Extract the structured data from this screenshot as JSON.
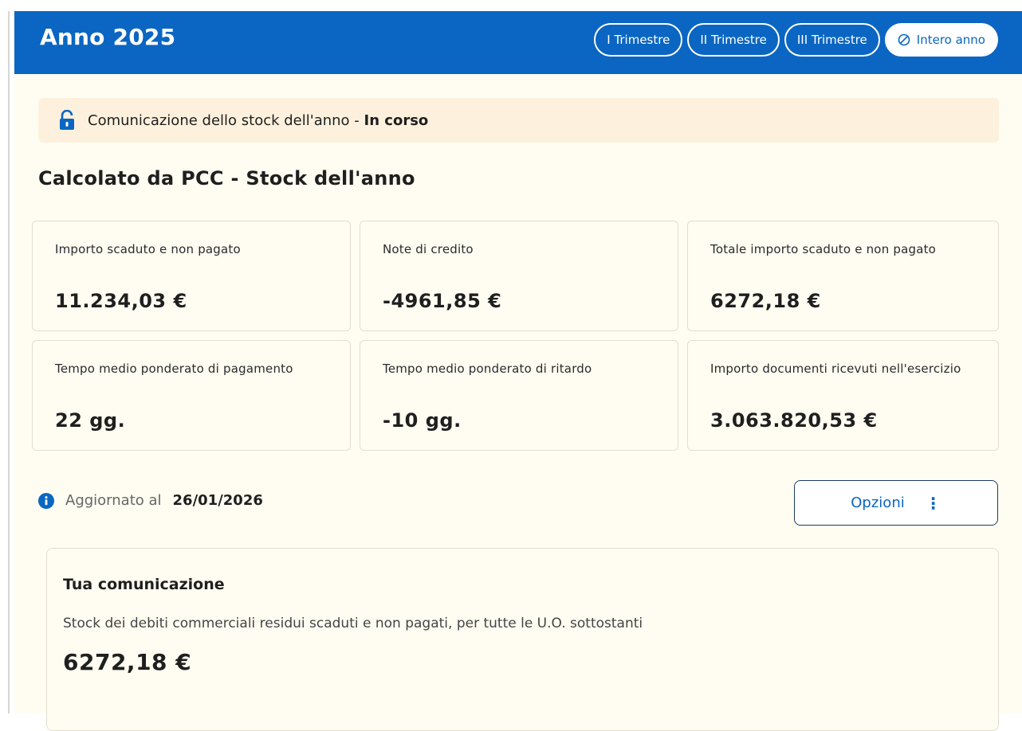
{
  "header": {
    "title": "Anno 2025",
    "periods": [
      {
        "label": "I Trimestre",
        "selected": false
      },
      {
        "label": "II Trimestre",
        "selected": false
      },
      {
        "label": "III Trimestre",
        "selected": false
      },
      {
        "label": "Intero anno",
        "selected": true,
        "icon": "slash-circle-icon"
      }
    ]
  },
  "notice": {
    "icon": "lock-icon",
    "text": "Comunicazione dello stock dell'anno",
    "separator": " - ",
    "status": "In corso"
  },
  "section_title": "Calcolato da PCC - Stock dell'anno",
  "cards": [
    {
      "label": "Importo scaduto e non pagato",
      "value": "11.234,03 €"
    },
    {
      "label": "Note di credito",
      "value": "-4961,85 €"
    },
    {
      "label": "Totale importo scaduto e non pagato",
      "value": "6272,18 €"
    },
    {
      "label": "Tempo medio ponderato di pagamento",
      "value": "22 gg."
    },
    {
      "label": "Tempo medio ponderato di ritardo",
      "value": "-10 gg."
    },
    {
      "label": "Importo documenti ricevuti nell'esercizio",
      "value": "3.063.820,53 €"
    }
  ],
  "updated": {
    "icon": "info-icon",
    "prefix": "Aggiornato al",
    "date": "26/01/2026"
  },
  "options_button": {
    "label": "Opzioni",
    "icon": "kebab-menu-icon"
  },
  "communication": {
    "title": "Tua comunicazione",
    "description": "Stock dei debiti commerciali residui scaduti e non pagati, per tutte le U.O. sottostanti",
    "value": "6272,18 €"
  },
  "colors": {
    "primary": "#0a66c2",
    "panel_bg": "#fffdf2",
    "notice_bg": "#fdf1dd",
    "border": "#e2ddcf"
  }
}
